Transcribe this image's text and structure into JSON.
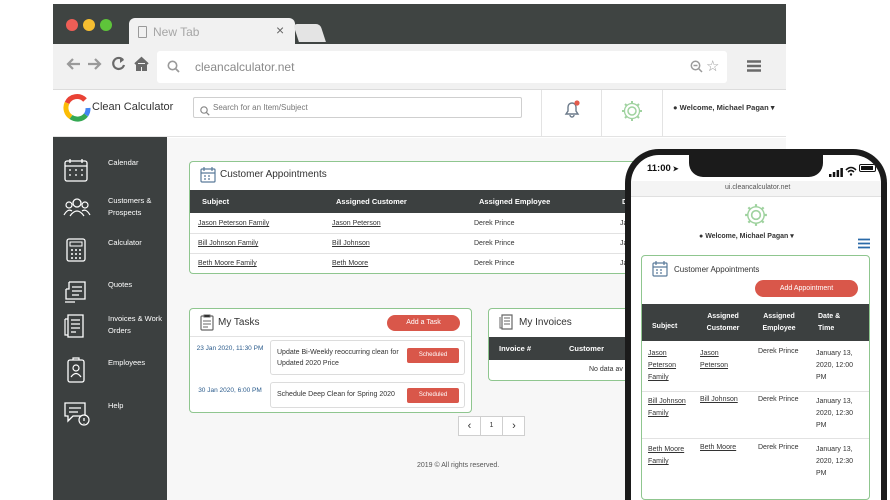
{
  "browser": {
    "tab_title": "New Tab",
    "tab_close": "×",
    "url": "cleancalculator.net",
    "traffic_colors": [
      "#ee5e56",
      "#f6be31",
      "#5ec43a"
    ]
  },
  "app": {
    "brand_name": "Clean Calculator",
    "search_placeholder": "Search for an Item/Subject",
    "welcome": "Welcome, Michael Pagan",
    "accent_color": "#d9574a",
    "panel_border_color": "#8fc68f",
    "sidebar_color": "#3c4040"
  },
  "sidebar": {
    "items": [
      {
        "label": "Calendar",
        "icon": "calendar-icon"
      },
      {
        "label": "Customers & Prospects",
        "icon": "customers-icon"
      },
      {
        "label": "Calculator",
        "icon": "calculator-icon"
      },
      {
        "label": "Quotes",
        "icon": "quotes-icon"
      },
      {
        "label": "Invoices & Work Orders",
        "icon": "invoices-icon"
      },
      {
        "label": "Employees",
        "icon": "employees-icon"
      },
      {
        "label": "Help",
        "icon": "help-icon"
      }
    ]
  },
  "appointments": {
    "title": "Customer Appointments",
    "headers": [
      "Subject",
      "Assigned Customer",
      "Assigned Employee",
      "D"
    ],
    "rows": [
      {
        "subject": "Jason Peterson Family",
        "customer": "Jason Peterson",
        "employee": "Derek Prince",
        "date": "Ja"
      },
      {
        "subject": "Bill Johnson Family",
        "customer": "Bill Johnson",
        "employee": "Derek Prince",
        "date": "Ja"
      },
      {
        "subject": "Beth Moore Family",
        "customer": "Beth Moore",
        "employee": "Derek Prince",
        "date": "Ja"
      }
    ]
  },
  "tasks": {
    "title": "My Tasks",
    "add_label": "Add a Task",
    "items": [
      {
        "date": "23 Jan 2020, 11:30 PM",
        "text": "Update Bi-Weekly reoccurring clean for Updated 2020 Price",
        "status": "Scheduled"
      },
      {
        "date": "30 Jan 2020, 6:00 PM",
        "text": "Schedule Deep Clean for Spring 2020",
        "status": "Scheduled"
      }
    ],
    "pagination": {
      "prev": "‹",
      "page": "1",
      "next": "›"
    }
  },
  "invoices": {
    "title": "My Invoices",
    "headers": [
      "Invoice #",
      "Customer"
    ],
    "empty_text": "No data av"
  },
  "footer": {
    "text": "2019 © All rights reserved."
  },
  "phone": {
    "time": "11:00",
    "url": "ui.cleancalculator.net",
    "welcome": "Welcome, Michael Pagan",
    "appointments_title": "Customer Appointments",
    "add_label": "Add Appointment",
    "headers": [
      "Subject",
      "Assigned Customer",
      "Assigned Employee",
      "Date & Time"
    ],
    "rows": [
      {
        "subject": "Jason Peterson Family",
        "customer": "Jason Peterson",
        "employee": "Derek Prince",
        "date": "January 13, 2020, 12:00 PM"
      },
      {
        "subject": "Bill Johnson Family",
        "customer": "Bill Johnson",
        "employee": "Derek Prince",
        "date": "January 13, 2020, 12:30 PM"
      },
      {
        "subject": "Beth Moore Family",
        "customer": "Beth Moore",
        "employee": "Derek Prince",
        "date": "January 13, 2020, 12:30 PM"
      }
    ]
  }
}
